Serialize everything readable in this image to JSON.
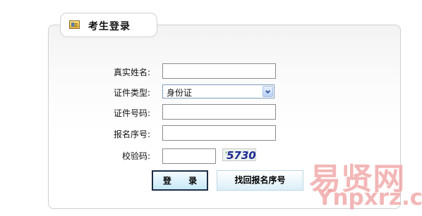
{
  "header": {
    "title": "考生登录",
    "icon": "id-card-icon"
  },
  "form": {
    "name_label": "真实姓名:",
    "name_value": "",
    "id_type_label": "证件类型:",
    "id_type_selected": "身份证",
    "id_number_label": "证件号码:",
    "id_number_value": "",
    "registration_number_label": "报名序号:",
    "registration_number_value": "",
    "verification_code_label": "校验码:",
    "verification_code_value": "",
    "captcha_text": "5730"
  },
  "buttons": {
    "login_label": "登 录",
    "retrieve_registration_number_label": "找回报名序号"
  },
  "watermark": {
    "main": "易贤网",
    "sub": "Ynpxrz.com"
  },
  "colors": {
    "watermark": "#ef9d9d",
    "login_border": "#1d2d46",
    "button_fill": "#dbeff9"
  }
}
